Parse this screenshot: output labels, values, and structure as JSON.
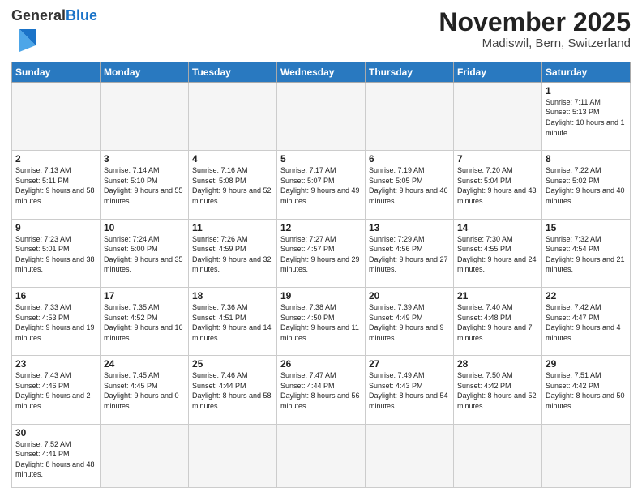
{
  "logo": {
    "text_general": "General",
    "text_blue": "Blue"
  },
  "title": "November 2025",
  "subtitle": "Madiswil, Bern, Switzerland",
  "days_of_week": [
    "Sunday",
    "Monday",
    "Tuesday",
    "Wednesday",
    "Thursday",
    "Friday",
    "Saturday"
  ],
  "weeks": [
    [
      {
        "day": "",
        "info": ""
      },
      {
        "day": "",
        "info": ""
      },
      {
        "day": "",
        "info": ""
      },
      {
        "day": "",
        "info": ""
      },
      {
        "day": "",
        "info": ""
      },
      {
        "day": "",
        "info": ""
      },
      {
        "day": "1",
        "info": "Sunrise: 7:11 AM\nSunset: 5:13 PM\nDaylight: 10 hours and 1 minute."
      }
    ],
    [
      {
        "day": "2",
        "info": "Sunrise: 7:13 AM\nSunset: 5:11 PM\nDaylight: 9 hours and 58 minutes."
      },
      {
        "day": "3",
        "info": "Sunrise: 7:14 AM\nSunset: 5:10 PM\nDaylight: 9 hours and 55 minutes."
      },
      {
        "day": "4",
        "info": "Sunrise: 7:16 AM\nSunset: 5:08 PM\nDaylight: 9 hours and 52 minutes."
      },
      {
        "day": "5",
        "info": "Sunrise: 7:17 AM\nSunset: 5:07 PM\nDaylight: 9 hours and 49 minutes."
      },
      {
        "day": "6",
        "info": "Sunrise: 7:19 AM\nSunset: 5:05 PM\nDaylight: 9 hours and 46 minutes."
      },
      {
        "day": "7",
        "info": "Sunrise: 7:20 AM\nSunset: 5:04 PM\nDaylight: 9 hours and 43 minutes."
      },
      {
        "day": "8",
        "info": "Sunrise: 7:22 AM\nSunset: 5:02 PM\nDaylight: 9 hours and 40 minutes."
      }
    ],
    [
      {
        "day": "9",
        "info": "Sunrise: 7:23 AM\nSunset: 5:01 PM\nDaylight: 9 hours and 38 minutes."
      },
      {
        "day": "10",
        "info": "Sunrise: 7:24 AM\nSunset: 5:00 PM\nDaylight: 9 hours and 35 minutes."
      },
      {
        "day": "11",
        "info": "Sunrise: 7:26 AM\nSunset: 4:59 PM\nDaylight: 9 hours and 32 minutes."
      },
      {
        "day": "12",
        "info": "Sunrise: 7:27 AM\nSunset: 4:57 PM\nDaylight: 9 hours and 29 minutes."
      },
      {
        "day": "13",
        "info": "Sunrise: 7:29 AM\nSunset: 4:56 PM\nDaylight: 9 hours and 27 minutes."
      },
      {
        "day": "14",
        "info": "Sunrise: 7:30 AM\nSunset: 4:55 PM\nDaylight: 9 hours and 24 minutes."
      },
      {
        "day": "15",
        "info": "Sunrise: 7:32 AM\nSunset: 4:54 PM\nDaylight: 9 hours and 21 minutes."
      }
    ],
    [
      {
        "day": "16",
        "info": "Sunrise: 7:33 AM\nSunset: 4:53 PM\nDaylight: 9 hours and 19 minutes."
      },
      {
        "day": "17",
        "info": "Sunrise: 7:35 AM\nSunset: 4:52 PM\nDaylight: 9 hours and 16 minutes."
      },
      {
        "day": "18",
        "info": "Sunrise: 7:36 AM\nSunset: 4:51 PM\nDaylight: 9 hours and 14 minutes."
      },
      {
        "day": "19",
        "info": "Sunrise: 7:38 AM\nSunset: 4:50 PM\nDaylight: 9 hours and 11 minutes."
      },
      {
        "day": "20",
        "info": "Sunrise: 7:39 AM\nSunset: 4:49 PM\nDaylight: 9 hours and 9 minutes."
      },
      {
        "day": "21",
        "info": "Sunrise: 7:40 AM\nSunset: 4:48 PM\nDaylight: 9 hours and 7 minutes."
      },
      {
        "day": "22",
        "info": "Sunrise: 7:42 AM\nSunset: 4:47 PM\nDaylight: 9 hours and 4 minutes."
      }
    ],
    [
      {
        "day": "23",
        "info": "Sunrise: 7:43 AM\nSunset: 4:46 PM\nDaylight: 9 hours and 2 minutes."
      },
      {
        "day": "24",
        "info": "Sunrise: 7:45 AM\nSunset: 4:45 PM\nDaylight: 9 hours and 0 minutes."
      },
      {
        "day": "25",
        "info": "Sunrise: 7:46 AM\nSunset: 4:44 PM\nDaylight: 8 hours and 58 minutes."
      },
      {
        "day": "26",
        "info": "Sunrise: 7:47 AM\nSunset: 4:44 PM\nDaylight: 8 hours and 56 minutes."
      },
      {
        "day": "27",
        "info": "Sunrise: 7:49 AM\nSunset: 4:43 PM\nDaylight: 8 hours and 54 minutes."
      },
      {
        "day": "28",
        "info": "Sunrise: 7:50 AM\nSunset: 4:42 PM\nDaylight: 8 hours and 52 minutes."
      },
      {
        "day": "29",
        "info": "Sunrise: 7:51 AM\nSunset: 4:42 PM\nDaylight: 8 hours and 50 minutes."
      }
    ],
    [
      {
        "day": "30",
        "info": "Sunrise: 7:52 AM\nSunset: 4:41 PM\nDaylight: 8 hours and 48 minutes."
      },
      {
        "day": "",
        "info": ""
      },
      {
        "day": "",
        "info": ""
      },
      {
        "day": "",
        "info": ""
      },
      {
        "day": "",
        "info": ""
      },
      {
        "day": "",
        "info": ""
      },
      {
        "day": "",
        "info": ""
      }
    ]
  ]
}
